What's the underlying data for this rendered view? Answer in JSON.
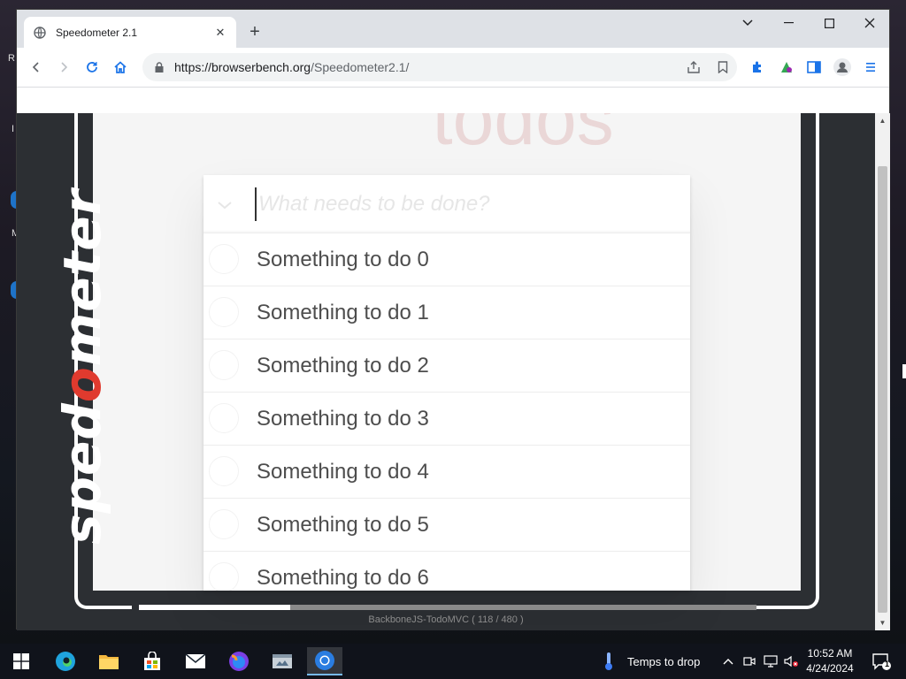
{
  "browser": {
    "tab_title": "Speedometer 2.1",
    "url_host": "https://browserbench.org",
    "url_path": "/Speedometer2.1/"
  },
  "page": {
    "logo_text_pre": "sped",
    "logo_text_o": "o",
    "logo_text_post": "meter",
    "todo_heading": "todos",
    "new_todo_placeholder": "What needs to be done?",
    "todos": [
      "Something to do 0",
      "Something to do 1",
      "Something to do 2",
      "Something to do 3",
      "Something to do 4",
      "Something to do 5",
      "Something to do 6"
    ],
    "status": "BackboneJS-TodoMVC ( 118 / 480 )",
    "progress": 0.245
  },
  "taskbar": {
    "weather_text": "Temps to drop",
    "time": "10:52 AM",
    "date": "4/24/2024",
    "notification_count": "1"
  },
  "colors": {
    "accent_red": "#e03a2e",
    "page_dark": "#2c2f33",
    "chrome_blue": "#1a73e8"
  }
}
